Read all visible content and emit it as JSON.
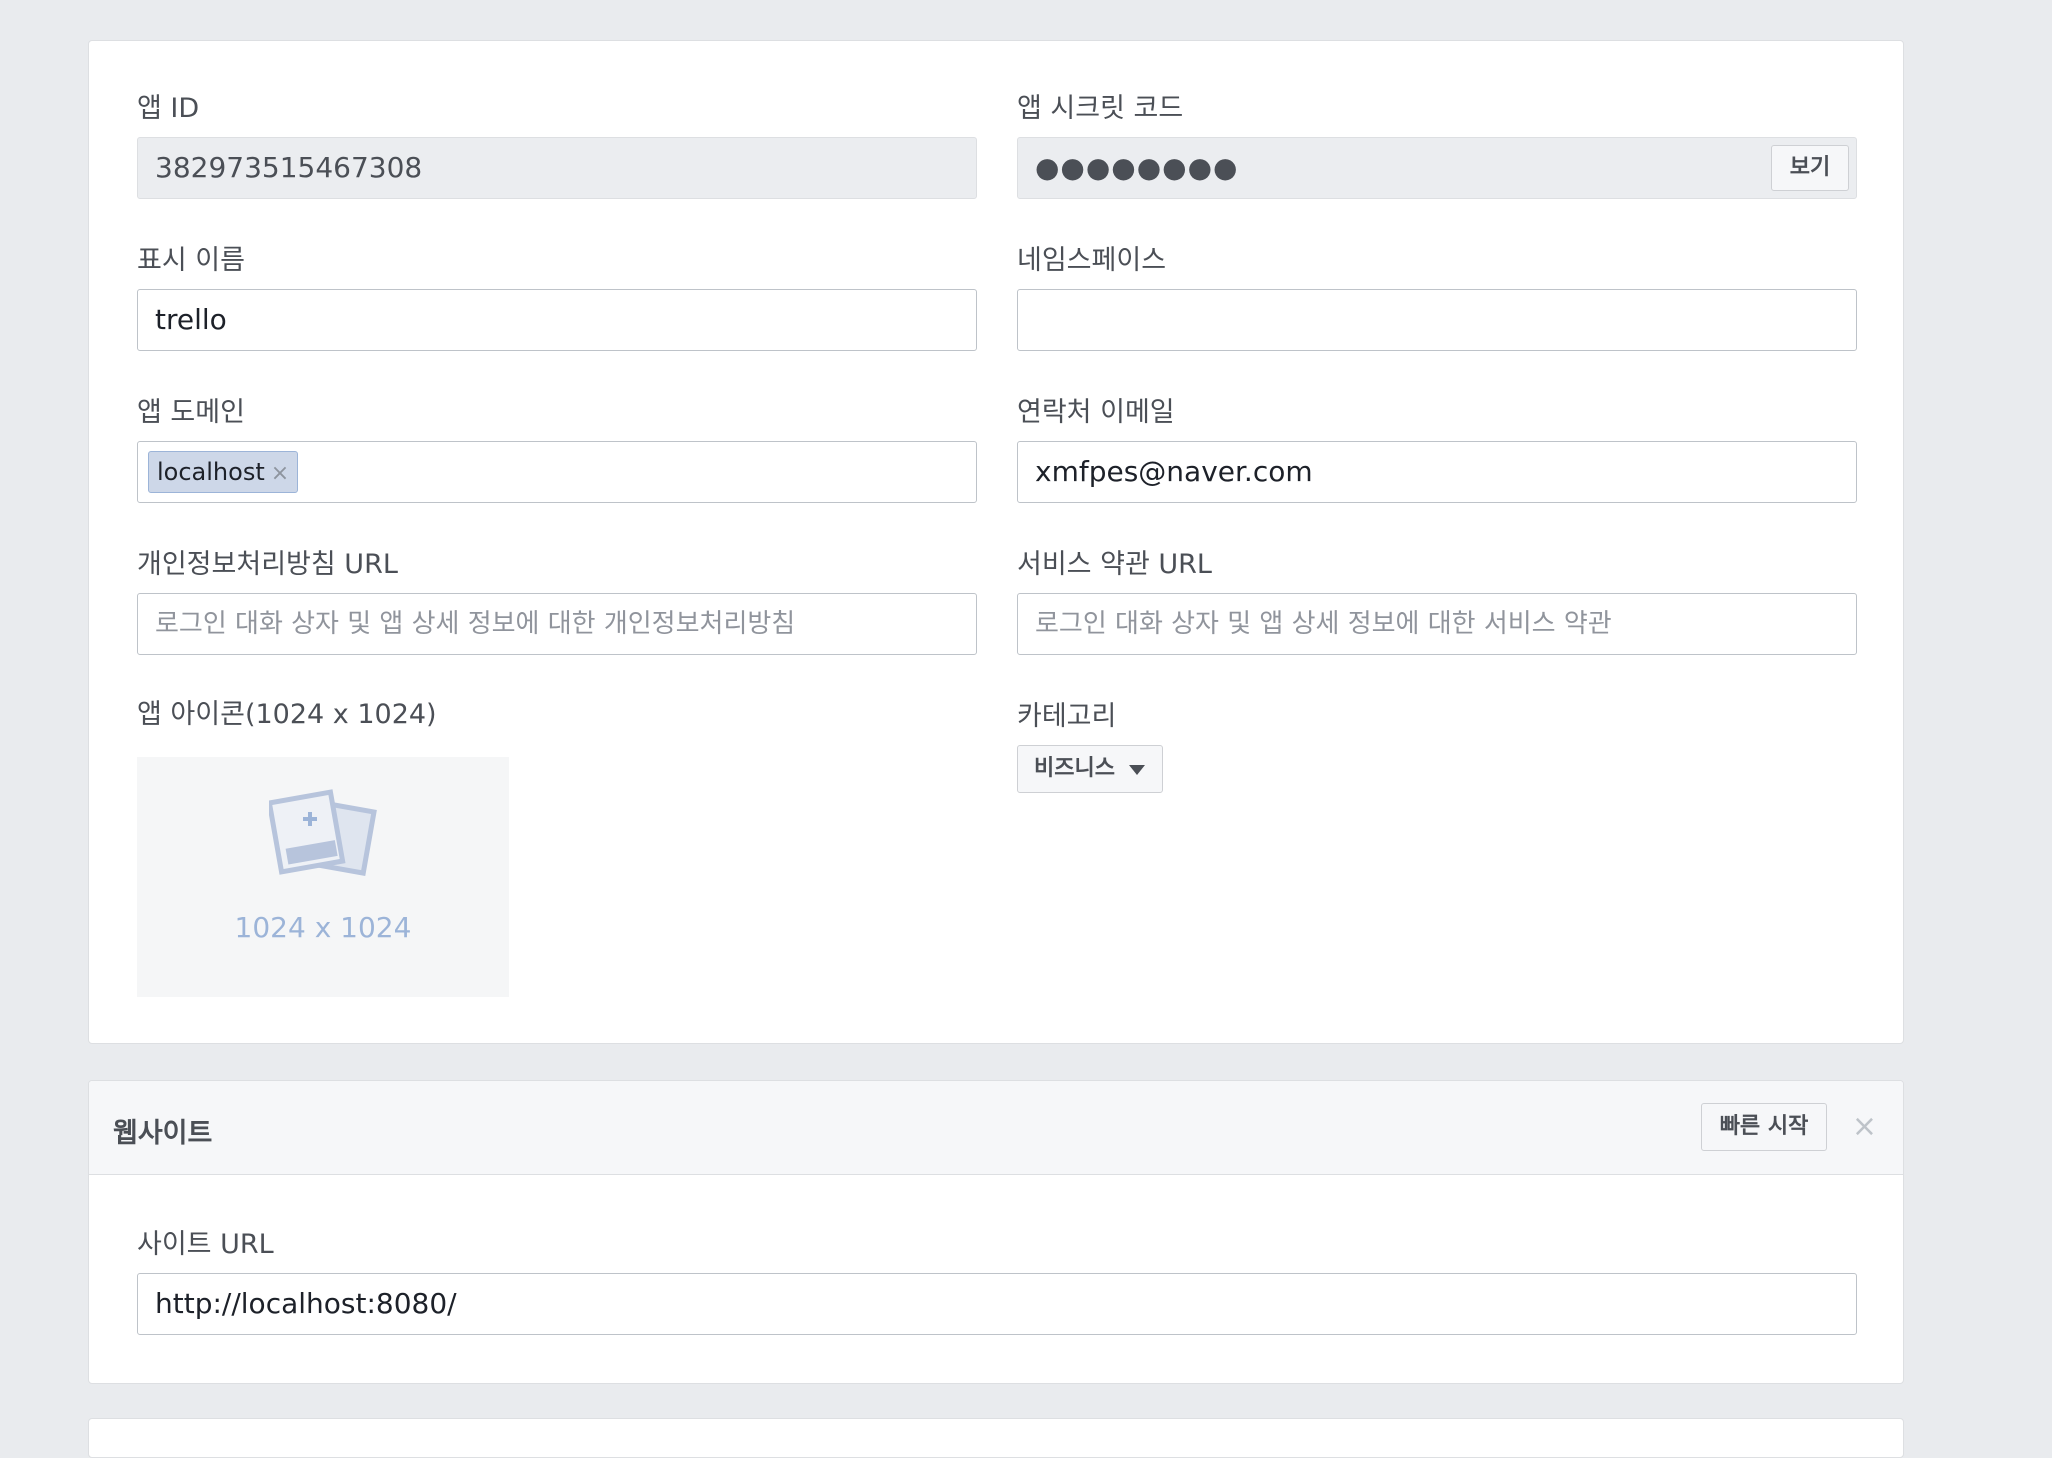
{
  "basic": {
    "app_id_label": "앱 ID",
    "app_id_value": "382973515467308",
    "app_secret_label": "앱 시크릿 코드",
    "app_secret_value": "●●●●●●●●",
    "show_button": "보기",
    "display_name_label": "표시 이름",
    "display_name_value": "trello",
    "namespace_label": "네임스페이스",
    "namespace_value": "",
    "app_domain_label": "앱 도메인",
    "app_domain_token": "localhost",
    "token_remove": "×",
    "contact_email_label": "연락처 이메일",
    "contact_email_value": "xmfpes@naver.com",
    "privacy_url_label": "개인정보처리방침 URL",
    "privacy_url_placeholder": "로그인 대화 상자 및 앱 상세 정보에 대한 개인정보처리방침",
    "terms_url_label": "서비스 약관 URL",
    "terms_url_placeholder": "로그인 대화 상자 및 앱 상세 정보에 대한 서비스 약관",
    "app_icon_label": "앱 아이콘(1024 x 1024)",
    "app_icon_size": "1024 x 1024",
    "category_label": "카테고리",
    "category_value": "비즈니스"
  },
  "website": {
    "title": "웹사이트",
    "quick_start": "빠른 시작",
    "close": "×",
    "site_url_label": "사이트 URL",
    "site_url_value": "http://localhost:8080/"
  },
  "colors": {
    "background": "#e9ebee",
    "token_bg": "#cdd7e8",
    "icon_placeholder": "#9cb4d8"
  }
}
